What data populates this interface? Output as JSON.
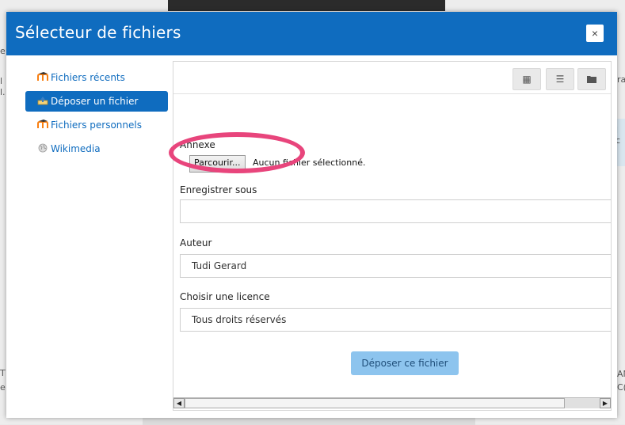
{
  "background": {
    "left_fragments": [
      "e",
      "l",
      "l.",
      "T",
      "e"
    ],
    "right_fragments": [
      "ra",
      "l c",
      "AN",
      "C("
    ]
  },
  "dialog": {
    "title": "Sélecteur de fichiers",
    "close_glyph": "×"
  },
  "nav": {
    "items": [
      {
        "label": "Fichiers récents",
        "icon": "moodle-icon",
        "active": false
      },
      {
        "label": "Déposer un fichier",
        "icon": "upload-icon",
        "active": true
      },
      {
        "label": "Fichiers personnels",
        "icon": "moodle-icon",
        "active": false
      },
      {
        "label": "Wikimedia",
        "icon": "wikimedia-globe-icon",
        "active": false
      }
    ]
  },
  "toolbar": {
    "views": [
      "grid-view-icon",
      "list-view-icon",
      "folder-view-icon"
    ]
  },
  "form": {
    "attachment_label": "Annexe",
    "browse_label": "Parcourir...",
    "no_file_text": "Aucun fichier sélectionné.",
    "save_as_label": "Enregistrer sous",
    "save_as_value": "",
    "author_label": "Auteur",
    "author_value": "Tudi Gerard",
    "license_label": "Choisir une licence",
    "license_value": "Tous droits réservés",
    "submit_label": "Déposer ce fichier"
  },
  "colors": {
    "accent": "#0f6cbf",
    "submit": "#8dc4ee",
    "highlight": "#e8457c"
  }
}
